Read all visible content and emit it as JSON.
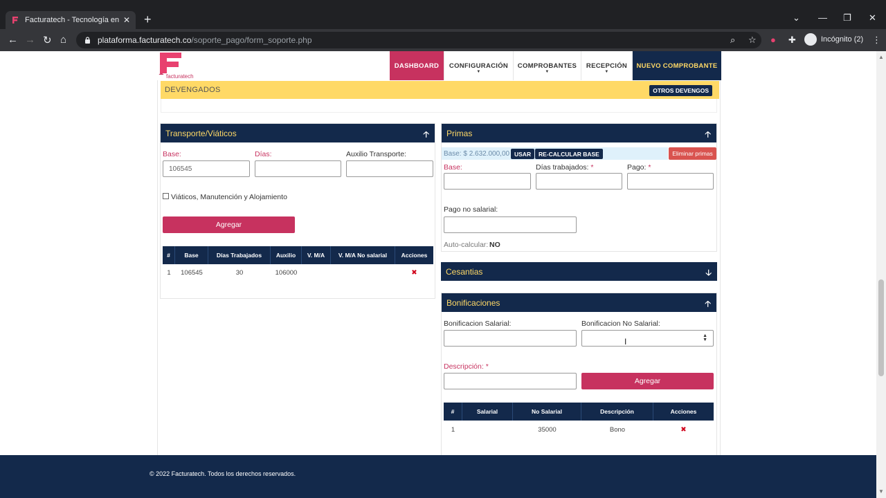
{
  "browser": {
    "tab_title": "Facturatech - Tecnología en factu",
    "url_host": "plataforma.facturatech.co",
    "url_path": "/soporte_pago/form_soporte.php",
    "profile_label": "Incógnito (2)"
  },
  "logo": {
    "text": "facturatech"
  },
  "nav": {
    "dashboard": "DASHBOARD",
    "configuracion": "CONFIGURACIÓN",
    "comprobantes": "COMPROBANTES",
    "recepcion": "RECEPCIÓN",
    "nuevo": "NUEVO COMPROBANTE"
  },
  "devengados": {
    "title": "DEVENGADOS",
    "otros_button": "OTROS DEVENGOS"
  },
  "transporte": {
    "title": "Transporte/Viáticos",
    "base_label": "Base:",
    "base_value": "106545",
    "dias_label": "Días:",
    "auxilio_label": "Auxilio Transporte:",
    "viaticos_label": "Viáticos, Manutención y Alojamiento",
    "agregar_button": "Agregar",
    "columns": [
      "#",
      "Base",
      "Días Trabajados",
      "Auxilio",
      "V. M/A",
      "V. M/A No salarial",
      "Acciones"
    ],
    "rows": [
      {
        "num": "1",
        "base": "106545",
        "dias": "30",
        "auxilio": "106000",
        "vma": "",
        "vma_ns": ""
      }
    ]
  },
  "primas": {
    "title": "Primas",
    "base_text": "Base: $ 2.632.000,00",
    "usar_button": "USAR",
    "recalc_button": "RE-CALCULAR BASE",
    "eliminar_button": "Eliminar primas",
    "base_label": "Base:",
    "dias_label": "Días trabajados:",
    "pago_label": "Pago:",
    "required_mark": "*",
    "pago_ns_label": "Pago no salarial:",
    "auto_label": "Auto-calcular:",
    "auto_value": "NO"
  },
  "cesantias": {
    "title": "Cesantias"
  },
  "bonificaciones": {
    "title": "Bonificaciones",
    "salarial_label": "Bonificacion Salarial:",
    "no_salarial_label": "Bonificacion No Salarial:",
    "descripcion_label": "Descripción:",
    "required_mark": "*",
    "agregar_button": "Agregar",
    "columns": [
      "#",
      "Salarial",
      "No Salarial",
      "Descripción",
      "Acciones"
    ],
    "rows": [
      {
        "num": "1",
        "salarial": "",
        "no_salarial": "35000",
        "descripcion": "Bono"
      }
    ]
  },
  "footer": {
    "text": "© 2022 Facturatech. Todos los derechos reservados."
  },
  "colors": {
    "navy": "#13294b",
    "crimson": "#c7325f",
    "gold": "#ffd966",
    "danger": "#d9534f"
  }
}
